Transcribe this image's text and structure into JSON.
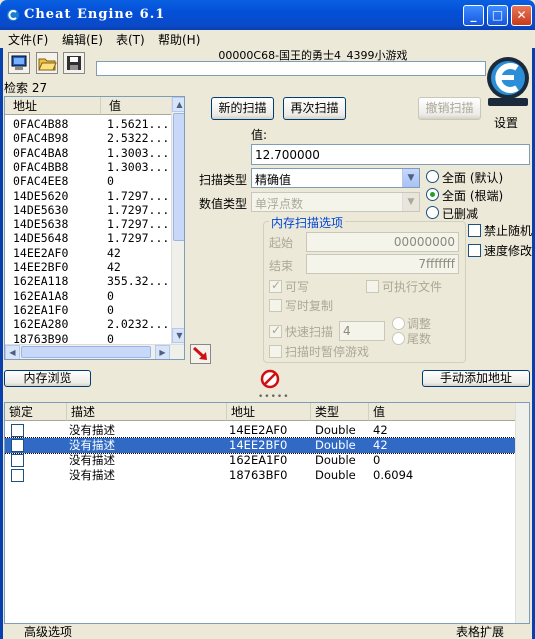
{
  "window": {
    "title": "Cheat Engine 6.1"
  },
  "menu": [
    {
      "label": "文件(F)"
    },
    {
      "label": "编辑(E)"
    },
    {
      "label": "表(T)"
    },
    {
      "label": "帮助(H)"
    }
  ],
  "process": {
    "title": "00000C68-国王的勇士4_4399小游戏"
  },
  "settings_label": "设置",
  "found": {
    "label": "检索 27"
  },
  "results": {
    "col_address": "地址",
    "col_value": "值",
    "rows": [
      {
        "address": "0FAC4B88",
        "value": "1.5621..."
      },
      {
        "address": "0FAC4B98",
        "value": "2.5322..."
      },
      {
        "address": "0FAC4BA8",
        "value": "1.3003..."
      },
      {
        "address": "0FAC4BB8",
        "value": "1.3003..."
      },
      {
        "address": "0FAC4EE8",
        "value": "0"
      },
      {
        "address": "14DE5620",
        "value": "1.7297..."
      },
      {
        "address": "14DE5630",
        "value": "1.7297..."
      },
      {
        "address": "14DE5638",
        "value": "1.7297..."
      },
      {
        "address": "14DE5648",
        "value": "1.7297..."
      },
      {
        "address": "14EE2AF0",
        "value": "42"
      },
      {
        "address": "14EE2BF0",
        "value": "42"
      },
      {
        "address": "162EA118",
        "value": "355.32..."
      },
      {
        "address": "162EA1A8",
        "value": "0"
      },
      {
        "address": "162EA1F0",
        "value": "0"
      },
      {
        "address": "162EA280",
        "value": "2.0232..."
      },
      {
        "address": "18763B90",
        "value": "0"
      }
    ]
  },
  "scan": {
    "new_scan": "新的扫描",
    "next_scan": "再次扫描",
    "undo_scan": "撤销扫描",
    "value_label": "值:",
    "value": "12.700000",
    "scan_type_label": "扫描类型",
    "scan_type_value": "精确值",
    "value_type_label": "数值类型",
    "value_type_value": "单浮点数",
    "radios": [
      {
        "label": "全面 (默认)",
        "checked": false
      },
      {
        "label": "全面 (根端)",
        "checked": true
      },
      {
        "label": "已删减",
        "checked": false
      }
    ],
    "disable_random": "禁止随机",
    "speed_modify": "速度修改"
  },
  "memory_options": {
    "title": "内存扫描选项",
    "start_label": "起始",
    "start_value": "00000000",
    "stop_label": "结束",
    "stop_value": "7fffffff",
    "writable": "可写",
    "executable": "可执行文件",
    "copy_on_write": "写时复制",
    "fast_scan": "快速扫描",
    "fast_scan_value": "4",
    "align": "调整",
    "last_digits": "尾数",
    "pause_game": "扫描时暂停游戏"
  },
  "buttons": {
    "memory_view": "内存浏览",
    "add_address": "手动添加地址"
  },
  "table": {
    "headers": [
      "锁定",
      "描述",
      "地址",
      "类型",
      "值"
    ],
    "rows": [
      {
        "description": "没有描述",
        "address": "14EE2AF0",
        "type": "Double",
        "value": "42",
        "selected": false
      },
      {
        "description": "没有描述",
        "address": "14EE2BF0",
        "type": "Double",
        "value": "42",
        "selected": true
      },
      {
        "description": "没有描述",
        "address": "162EA1F0",
        "type": "Double",
        "value": "0",
        "selected": false
      },
      {
        "description": "没有描述",
        "address": "18763BF0",
        "type": "Double",
        "value": "0.6094",
        "selected": false
      }
    ]
  },
  "status": {
    "advanced": "高级选项",
    "table_extras": "表格扩展"
  },
  "colors": {
    "titlebar": "#0a4ac8",
    "selection": "#316ac5",
    "group_title": "#0046d5"
  }
}
